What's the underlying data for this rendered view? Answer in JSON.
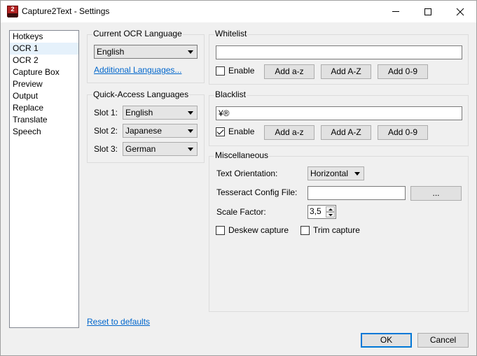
{
  "window": {
    "title": "Capture2Text - Settings"
  },
  "nav": {
    "items": [
      {
        "label": "Hotkeys",
        "selected": false
      },
      {
        "label": "OCR 1",
        "selected": true
      },
      {
        "label": "OCR 2",
        "selected": false
      },
      {
        "label": "Capture Box",
        "selected": false
      },
      {
        "label": "Preview",
        "selected": false
      },
      {
        "label": "Output",
        "selected": false
      },
      {
        "label": "Replace",
        "selected": false
      },
      {
        "label": "Translate",
        "selected": false
      },
      {
        "label": "Speech",
        "selected": false
      }
    ]
  },
  "current_ocr": {
    "title": "Current OCR Language",
    "language": "English",
    "additional_link": "Additional Languages..."
  },
  "quick_access": {
    "title": "Quick-Access Languages",
    "slots": [
      {
        "label": "Slot 1:",
        "value": "English"
      },
      {
        "label": "Slot 2:",
        "value": "Japanese"
      },
      {
        "label": "Slot 3:",
        "value": "German"
      }
    ]
  },
  "whitelist": {
    "title": "Whitelist",
    "value": "",
    "enable_label": "Enable",
    "enabled": false,
    "buttons": [
      "Add a-z",
      "Add A-Z",
      "Add 0-9"
    ]
  },
  "blacklist": {
    "title": "Blacklist",
    "value": "¥®",
    "enable_label": "Enable",
    "enabled": true,
    "buttons": [
      "Add a-z",
      "Add A-Z",
      "Add 0-9"
    ]
  },
  "misc": {
    "title": "Miscellaneous",
    "orientation_label": "Text Orientation:",
    "orientation_value": "Horizontal",
    "tess_label": "Tesseract Config File:",
    "tess_value": "",
    "browse_label": "...",
    "scale_label": "Scale Factor:",
    "scale_value": "3,5",
    "deskew_label": "Deskew capture",
    "deskew_checked": false,
    "trim_label": "Trim capture",
    "trim_checked": false
  },
  "footer": {
    "reset_link": "Reset to defaults",
    "ok_label": "OK",
    "cancel_label": "Cancel"
  }
}
